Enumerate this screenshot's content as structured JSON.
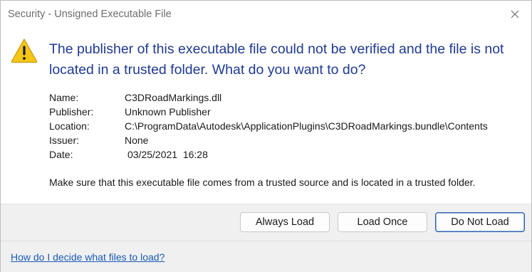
{
  "window": {
    "title": "Security - Unsigned Executable File",
    "close_icon": "close-icon"
  },
  "message": {
    "icon": "warning-icon",
    "icon_color": "#F5C518",
    "headline": "The publisher of this executable file could not be verified and the file is not located in a trusted folder. What do you want to do?",
    "headline_color": "#1F3A93"
  },
  "details": {
    "name": {
      "label": "Name:",
      "value": "C3DRoadMarkings.dll"
    },
    "publisher": {
      "label": "Publisher:",
      "value": "Unknown Publisher"
    },
    "location": {
      "label": "Location:",
      "value": "C:\\ProgramData\\Autodesk\\ApplicationPlugins\\C3DRoadMarkings.bundle\\Contents"
    },
    "issuer": {
      "label": "Issuer:",
      "value": "None"
    },
    "date": {
      "label": "Date:",
      "value": "03/25/2021  16:28"
    }
  },
  "advice": "Make sure that this executable file comes from a trusted source and is located in a trusted folder.",
  "buttons": {
    "always_load": "Always Load",
    "load_once": "Load Once",
    "do_not_load": "Do Not Load"
  },
  "help_link": "How do I decide what files to load?",
  "colors": {
    "footer_bg": "#F0F0F0",
    "primary_border": "#2F5FB3",
    "link": "#1A5BB5"
  }
}
